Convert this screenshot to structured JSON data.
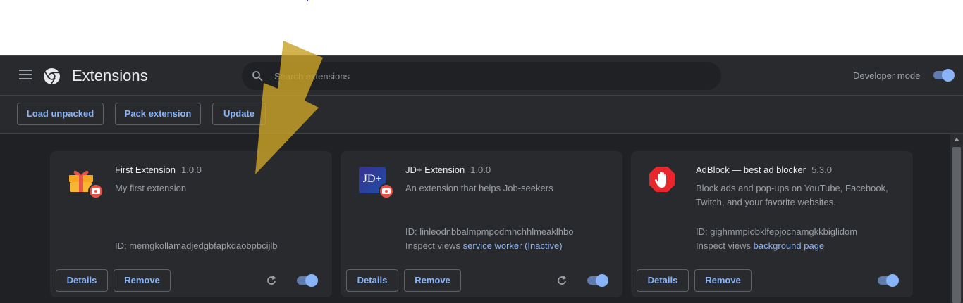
{
  "page": {
    "title": "Extensions"
  },
  "search": {
    "placeholder": "Search extensions",
    "value": ""
  },
  "developer_mode": {
    "label": "Developer mode",
    "enabled": true
  },
  "toolbar": {
    "load_unpacked": "Load unpacked",
    "pack_extension": "Pack extension",
    "update": "Update"
  },
  "extensions": [
    {
      "name": "First Extension",
      "version": "1.0.0",
      "description": "My first extension",
      "id_label": "ID: memgkollamadjedgbfapkdaobpbcijlb",
      "inspect_label": "",
      "inspect_link": "",
      "enabled": true,
      "details": "Details",
      "remove": "Remove"
    },
    {
      "name": "JD+ Extension",
      "version": "1.0.0",
      "description": "An extension that helps Job-seekers",
      "id_label": "ID: linleodnbbalmpmpodmhchhlmeaklhbo",
      "inspect_label": "Inspect views",
      "inspect_link": "service worker (Inactive)",
      "icon_text": "JD+",
      "enabled": true,
      "details": "Details",
      "remove": "Remove"
    },
    {
      "name": "AdBlock — best ad blocker",
      "version": "5.3.0",
      "description": "Block ads and pop-ups on YouTube, Facebook, Twitch, and your favorite websites.",
      "id_label": "ID: gighmmpiobklfepjocnamgkkbiglidom",
      "inspect_label": "Inspect views",
      "inspect_link": "background page",
      "enabled": true,
      "details": "Details",
      "remove": "Remove"
    }
  ],
  "colors": {
    "accent": "#8ab4f8",
    "background": "#202124",
    "card": "#292a2d",
    "overlay_arrow": "#c9a227"
  },
  "icons": [
    "menu-icon",
    "chrome-logo-icon",
    "search-icon",
    "gift-icon",
    "jd-plus-icon",
    "adblock-hand-icon",
    "reload-icon",
    "developer-badge-icon"
  ]
}
